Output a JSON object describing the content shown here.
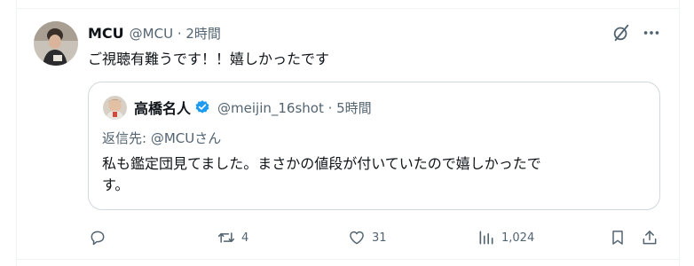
{
  "tweet": {
    "author_name": "MCU",
    "meta": "@MCU · 2時間",
    "text": "ご視聴有難うです！！嬉しかったです",
    "avatar_icon": "user-avatar"
  },
  "header_icons": {
    "grok": "grok-icon",
    "more": "more-icon"
  },
  "quote": {
    "author_name": "高橋名人",
    "meta": "@meijin_16shot · 5時間",
    "reply_to_label": "返信先: ",
    "reply_to_handle": "@MCUさん",
    "text_line1": "私も鑑定団見てました。まさかの値段が付いていたので嬉しかったで",
    "text_line2": "す。",
    "verified_color": "#1d9bf0"
  },
  "actions": {
    "replies": "",
    "retweets": "4",
    "likes": "31",
    "views": "1,024"
  },
  "colors": {
    "text": "#0f1419",
    "secondary": "#536471",
    "border": "#cfd9de",
    "verified": "#1d9bf0"
  }
}
